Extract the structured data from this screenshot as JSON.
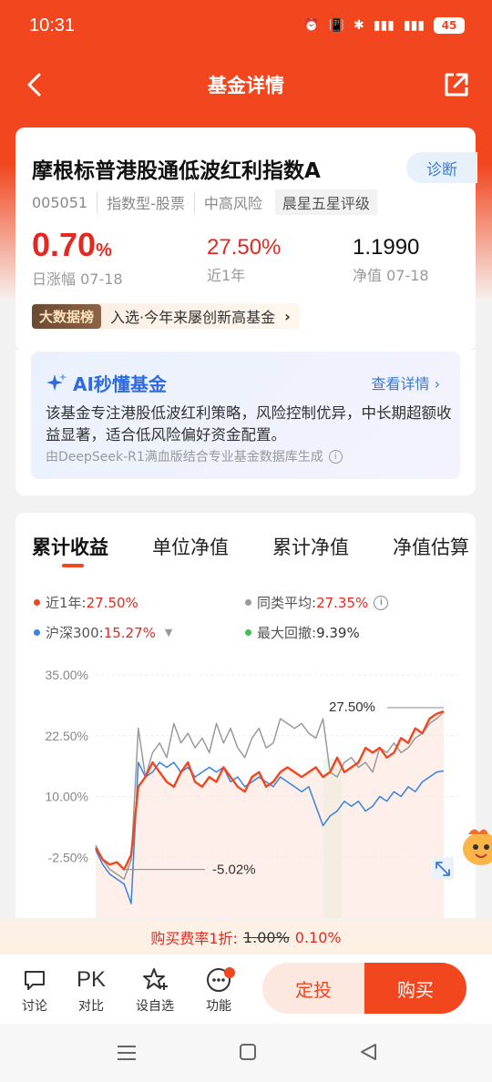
{
  "status": {
    "time": "10:31",
    "battery": "45"
  },
  "nav": {
    "title": "基金详情"
  },
  "fund": {
    "name": "摩根标普港股通低波红利指数A",
    "diagnose": "诊断",
    "code": "005051",
    "type": "指数型-股票",
    "risk": "中高风险",
    "rating": "晨星五星评级",
    "daily_change": "0.70",
    "daily_change_unit": "%",
    "daily_label": "日涨幅 07-18",
    "one_year": "27.50%",
    "one_year_label": "近1年",
    "nav": "1.1990",
    "nav_label": "净值 07-18",
    "bigdata_badge": "大数据榜",
    "bigdata_text": "入选·今年来屡创新高基金"
  },
  "ai": {
    "title": "AI秒懂基金",
    "more": "查看详情 ›",
    "text": "该基金专注港股低波红利策略，风险控制优异，中长期超额收益显著，适合低风险偏好资金配置。",
    "source": "由DeepSeek-R1满血版结合专业基金数据库生成"
  },
  "tabs": [
    "累计收益",
    "单位净值",
    "累计净值",
    "净值估算"
  ],
  "legend": {
    "fund_label": "近1年:",
    "fund_value": "27.50%",
    "avg_label": "同类平均:",
    "avg_value": "27.35%",
    "hs300_label": "沪深300:",
    "hs300_value": "15.27%",
    "drawdown_label": "最大回撤:",
    "drawdown_value": "9.39%"
  },
  "chart_data": {
    "type": "line",
    "y_ticks": [
      "35.00%",
      "22.50%",
      "10.00%",
      "-2.50%"
    ],
    "ylim": [
      -15,
      35
    ],
    "annotations": {
      "end": "27.50%",
      "min": "-5.02%"
    },
    "series": [
      {
        "name": "近1年",
        "color": "#f2461f",
        "values": [
          -0.5,
          -3,
          -4,
          -3.5,
          -5,
          -2,
          12,
          14,
          17,
          15,
          13,
          12,
          15,
          17,
          13,
          12,
          14,
          13,
          16,
          14,
          12,
          11,
          14,
          15,
          12,
          13,
          15,
          16,
          15,
          14,
          15,
          16,
          14,
          15,
          18,
          15,
          16,
          17,
          20,
          19,
          20,
          18,
          19,
          22,
          21,
          24,
          23,
          26,
          27,
          27.5
        ]
      },
      {
        "name": "同类平均",
        "color": "#9a9a9a",
        "values": [
          0,
          -3,
          -5,
          -6,
          -7,
          -3,
          24,
          14,
          19,
          21,
          18,
          25,
          21,
          23,
          20,
          22,
          19,
          25,
          21,
          24,
          20,
          18,
          22,
          24,
          20,
          21,
          26,
          25,
          24,
          25,
          23,
          22,
          26,
          15,
          14,
          17,
          18,
          16,
          17,
          15,
          20,
          19,
          21,
          19,
          20,
          22,
          23,
          25,
          26,
          27.35
        ]
      },
      {
        "name": "沪深300",
        "color": "#3a82e0",
        "values": [
          -1,
          -4,
          -6,
          -7,
          -8,
          -12,
          17,
          14,
          15,
          17,
          16,
          17,
          15,
          16,
          14,
          15,
          16,
          15,
          16,
          13,
          14,
          12,
          13,
          14,
          13,
          12,
          14,
          13,
          12,
          11,
          12,
          8,
          4,
          6,
          7,
          9,
          8,
          9,
          7,
          8,
          10,
          9,
          11,
          10,
          12,
          11,
          13,
          14,
          15,
          15.27
        ]
      }
    ]
  },
  "fee": {
    "label": "购买费率1折:",
    "old": "1.00%",
    "new": "0.10%"
  },
  "bottom": {
    "discuss": "讨论",
    "pk_icon": "PK",
    "compare": "对比",
    "watchlist": "设自选",
    "function": "功能",
    "fixed": "定投",
    "buy": "购买"
  }
}
